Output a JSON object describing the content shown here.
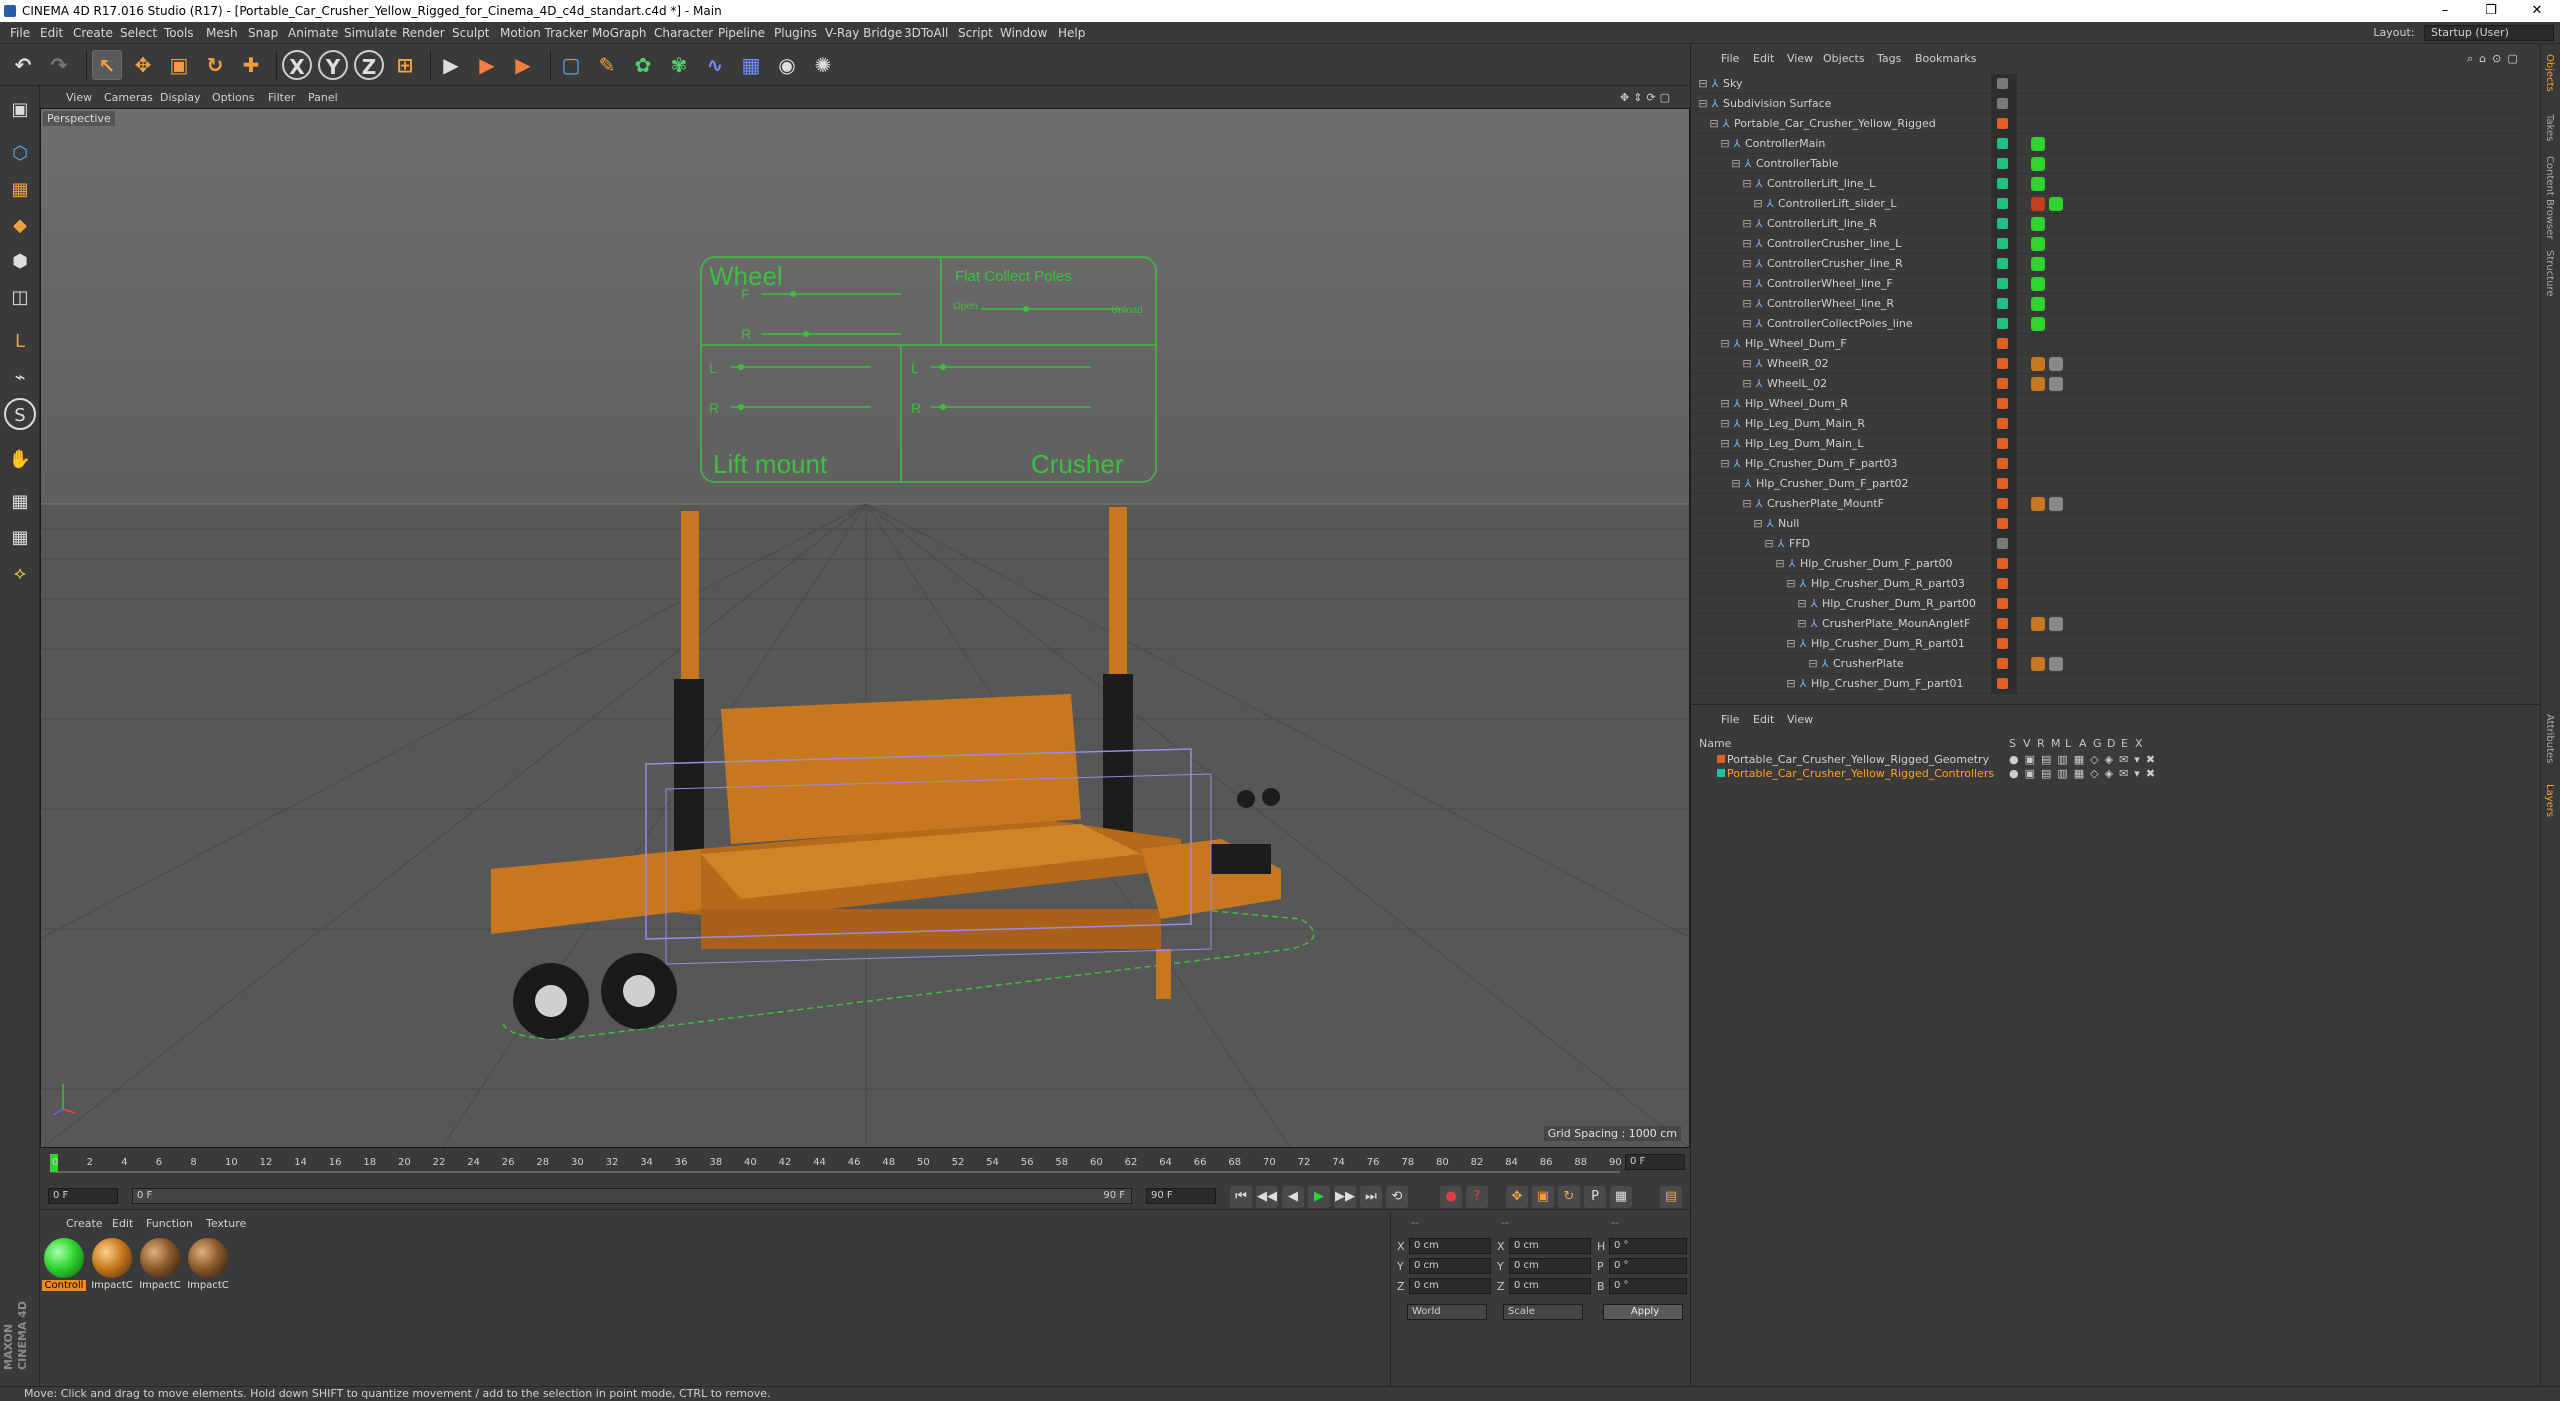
{
  "window": {
    "title": "CINEMA 4D R17.016 Studio (R17) - [Portable_Car_Crusher_Yellow_Rigged_for_Cinema_4D_c4d_standart.c4d *] - Main",
    "min": "–",
    "max": "❐",
    "close": "✕"
  },
  "menu": [
    "File",
    "Edit",
    "Create",
    "Select",
    "Tools",
    "Mesh",
    "Snap",
    "Animate",
    "Simulate",
    "Render",
    "Sculpt",
    "Motion Tracker",
    "MoGraph",
    "Character",
    "Pipeline",
    "Plugins",
    "V-Ray Bridge",
    "3DToAll",
    "Script",
    "Window",
    "Help"
  ],
  "layout": {
    "label": "Layout:",
    "value": "Startup (User)"
  },
  "toolbar": {
    "undo": "↶",
    "redo": "↷",
    "select": "↖",
    "move": "✥",
    "scale": "▣",
    "rotate": "↻",
    "add": "✚",
    "x": "X",
    "y": "Y",
    "z": "Z",
    "coord": "⊞",
    "render1": "▶",
    "render2": "▶",
    "render3": "▶",
    "cube": "▢",
    "pen": "✎",
    "gen": "✿",
    "deform": "✾",
    "spline": "∿",
    "floor": "▦",
    "camera": "◉",
    "light": "✺"
  },
  "lefttools": [
    "▣",
    "⬡",
    "▦",
    "◆",
    "⬢",
    "◫",
    "L",
    "⌁",
    "S",
    "✋",
    "▦",
    "▦",
    "⟡"
  ],
  "maxon": {
    "line1": "MAXON",
    "line2": "CINEMA 4D"
  },
  "viewport": {
    "menu": [
      "View",
      "Cameras",
      "Display",
      "Options",
      "Filter",
      "Panel"
    ],
    "label": "Perspective",
    "grid_spacing": "Grid Spacing : 1000 cm",
    "hud": {
      "wheel": "Wheel",
      "f": "F",
      "r": "R",
      "flat_collect": "Flat Collect Poles",
      "open": "Open",
      "unload": "Unload",
      "l1": "L",
      "r1": "R",
      "l2": "L",
      "r2": "R",
      "lift_mount": "Lift mount",
      "crusher": "Crusher"
    }
  },
  "timeline": {
    "ticks": [
      "0",
      "2",
      "4",
      "6",
      "8",
      "10",
      "12",
      "14",
      "16",
      "18",
      "20",
      "22",
      "24",
      "26",
      "28",
      "30",
      "32",
      "34",
      "36",
      "38",
      "40",
      "42",
      "44",
      "46",
      "48",
      "50",
      "52",
      "54",
      "56",
      "58",
      "60",
      "62",
      "64",
      "66",
      "68",
      "70",
      "72",
      "74",
      "76",
      "78",
      "80",
      "82",
      "84",
      "86",
      "88",
      "90"
    ],
    "frame_field": "0 F",
    "start": "0 F",
    "current": "0 F",
    "end_field": "90 F",
    "end": "90 F"
  },
  "transport": [
    "⏮",
    "◀◀",
    "◀",
    "▶",
    "▶▶",
    "⏭",
    "⟲",
    "●",
    "?",
    "✥",
    "▣",
    "↻",
    "P",
    "▦",
    "▤"
  ],
  "materials": {
    "menu": [
      "Create",
      "Edit",
      "Function",
      "Texture"
    ],
    "items": [
      {
        "name": "Controll",
        "color": "#2fd42f"
      },
      {
        "name": "ImpactC",
        "color": "#c7781e"
      },
      {
        "name": "ImpactC",
        "color": "#8a5a2a"
      },
      {
        "name": "ImpactC",
        "color": "#8a5a2a"
      }
    ]
  },
  "coords": {
    "header_dashes": "--",
    "rows": [
      {
        "a": "X",
        "av": "0 cm",
        "b": "X",
        "bv": "0 cm",
        "c": "H",
        "cv": "0 °"
      },
      {
        "a": "Y",
        "av": "0 cm",
        "b": "Y",
        "bv": "0 cm",
        "c": "P",
        "cv": "0 °"
      },
      {
        "a": "Z",
        "av": "0 cm",
        "b": "Z",
        "bv": "0 cm",
        "c": "B",
        "cv": "0 °"
      }
    ],
    "world": "World",
    "scale": "Scale",
    "apply": "Apply"
  },
  "status": "Move: Click and drag to move elements. Hold down SHIFT to quantize movement / add to the selection in point mode, CTRL to remove.",
  "objects": {
    "menu": [
      "File",
      "Edit",
      "View",
      "Objects",
      "Tags",
      "Bookmarks"
    ],
    "rows": [
      {
        "name": "Sky",
        "indent": 0,
        "color": "#7a7a7a",
        "tags": []
      },
      {
        "name": "Subdivision Surface",
        "indent": 0,
        "color": "#7a7a7a",
        "tags": []
      },
      {
        "name": "Portable_Car_Crusher_Yellow_Rigged",
        "indent": 1,
        "color": "#e06020",
        "tags": []
      },
      {
        "name": "ControllerMain",
        "indent": 2,
        "color": "#20c080",
        "tags": [
          "#2fd42f"
        ]
      },
      {
        "name": "ControllerTable",
        "indent": 3,
        "color": "#20c080",
        "tags": [
          "#2fd42f"
        ]
      },
      {
        "name": "ControllerLift_line_L",
        "indent": 4,
        "color": "#20c080",
        "tags": [
          "#2fd42f"
        ]
      },
      {
        "name": "ControllerLift_slider_L",
        "indent": 5,
        "color": "#20c080",
        "tags": [
          "#c04020",
          "#2fd42f"
        ]
      },
      {
        "name": "ControllerLift_line_R",
        "indent": 4,
        "color": "#20c080",
        "tags": [
          "#2fd42f"
        ]
      },
      {
        "name": "ControllerCrusher_line_L",
        "indent": 4,
        "color": "#20c080",
        "tags": [
          "#2fd42f"
        ]
      },
      {
        "name": "ControllerCrusher_line_R",
        "indent": 4,
        "color": "#20c080",
        "tags": [
          "#2fd42f"
        ]
      },
      {
        "name": "ControllerWheel_line_F",
        "indent": 4,
        "color": "#20c080",
        "tags": [
          "#2fd42f"
        ]
      },
      {
        "name": "ControllerWheel_line_R",
        "indent": 4,
        "color": "#20c080",
        "tags": [
          "#2fd42f"
        ]
      },
      {
        "name": "ControllerCollectPoles_line",
        "indent": 4,
        "color": "#20c080",
        "tags": [
          "#2fd42f"
        ]
      },
      {
        "name": "Hlp_Wheel_Dum_F",
        "indent": 2,
        "color": "#e06020",
        "tags": []
      },
      {
        "name": "WheelR_02",
        "indent": 4,
        "color": "#e06020",
        "tags": [
          "#c7781e",
          "#888"
        ]
      },
      {
        "name": "WheelL_02",
        "indent": 4,
        "color": "#e06020",
        "tags": [
          "#c7781e",
          "#888"
        ]
      },
      {
        "name": "Hlp_Wheel_Dum_R",
        "indent": 2,
        "color": "#e06020",
        "tags": []
      },
      {
        "name": "Hlp_Leg_Dum_Main_R",
        "indent": 2,
        "color": "#e06020",
        "tags": []
      },
      {
        "name": "Hlp_Leg_Dum_Main_L",
        "indent": 2,
        "color": "#e06020",
        "tags": []
      },
      {
        "name": "Hlp_Crusher_Dum_F_part03",
        "indent": 2,
        "color": "#e06020",
        "tags": []
      },
      {
        "name": "Hlp_Crusher_Dum_F_part02",
        "indent": 3,
        "color": "#e06020",
        "tags": []
      },
      {
        "name": "CrusherPlate_MountF",
        "indent": 4,
        "color": "#e06020",
        "tags": [
          "#c7781e",
          "#888"
        ]
      },
      {
        "name": "Null",
        "indent": 5,
        "color": "#e06020",
        "tags": []
      },
      {
        "name": "FFD",
        "indent": 6,
        "color": "#7a7a7a",
        "tags": []
      },
      {
        "name": "Hlp_Crusher_Dum_F_part00",
        "indent": 7,
        "color": "#e06020",
        "tags": []
      },
      {
        "name": "Hlp_Crusher_Dum_R_part03",
        "indent": 8,
        "color": "#e06020",
        "tags": []
      },
      {
        "name": "Hlp_Crusher_Dum_R_part00",
        "indent": 9,
        "color": "#e06020",
        "tags": []
      },
      {
        "name": "CrusherPlate_MounAngletF",
        "indent": 9,
        "color": "#e06020",
        "tags": [
          "#c7781e",
          "#888"
        ]
      },
      {
        "name": "Hlp_Crusher_Dum_R_part01",
        "indent": 8,
        "color": "#e06020",
        "tags": []
      },
      {
        "name": "CrusherPlate",
        "indent": 10,
        "color": "#e06020",
        "tags": [
          "#c7781e",
          "#888"
        ]
      },
      {
        "name": "Hlp_Crusher_Dum_F_part01",
        "indent": 8,
        "color": "#e06020",
        "tags": []
      }
    ]
  },
  "layers": {
    "menu": [
      "File",
      "Edit",
      "View"
    ],
    "header": {
      "name": "Name",
      "cols": [
        "S",
        "V",
        "R",
        "M",
        "L",
        "A",
        "G",
        "D",
        "E",
        "X"
      ]
    },
    "rows": [
      {
        "name": "Portable_Car_Crusher_Yellow_Rigged_Geometry",
        "color": "#e06020",
        "text": "#d0d0d0"
      },
      {
        "name": "Portable_Car_Crusher_Yellow_Rigged_Controllers",
        "color": "#20c0a0",
        "text": "#ffa020"
      }
    ]
  },
  "side_tabs": [
    "Objects",
    "Takes",
    "Content Browser",
    "Structure",
    "Attributes",
    "Layers"
  ]
}
